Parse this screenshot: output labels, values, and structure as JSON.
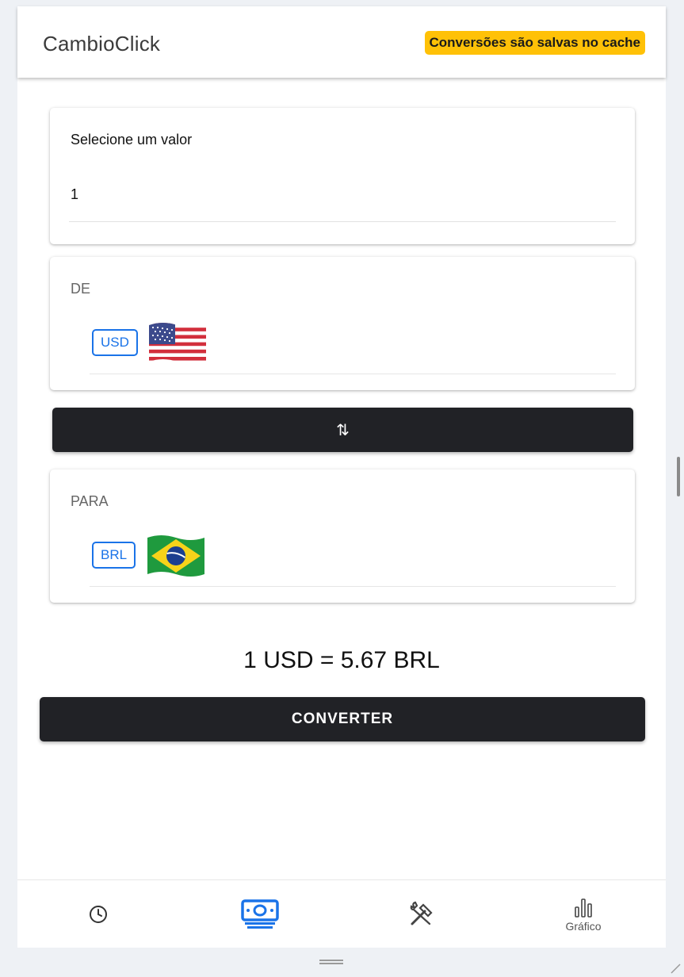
{
  "header": {
    "title": "CambioClick",
    "cache_notice": "Conversões são salvas no cache"
  },
  "amount": {
    "label": "Selecione um valor",
    "value": "1"
  },
  "from": {
    "label": "DE",
    "code": "USD",
    "flag_icon": "flag-us-icon"
  },
  "to": {
    "label": "PARA",
    "code": "BRL",
    "flag_icon": "flag-br-icon"
  },
  "swap": {
    "icon": "swap-vertical-icon",
    "glyph": "⇅"
  },
  "result": {
    "text": "1 USD = 5.67 BRL"
  },
  "convert": {
    "label": "CONVERTER"
  },
  "nav": {
    "items": [
      {
        "id": "history",
        "icon": "clock-icon",
        "label": ""
      },
      {
        "id": "convert",
        "icon": "money-icon",
        "label": "",
        "active": true
      },
      {
        "id": "tools",
        "icon": "tools-icon",
        "label": ""
      },
      {
        "id": "chart",
        "icon": "bar-chart-icon",
        "label": "Gráfico"
      }
    ]
  },
  "colors": {
    "accent": "#1a73e8",
    "badge": "#ffc107",
    "button_dark": "#212226"
  }
}
